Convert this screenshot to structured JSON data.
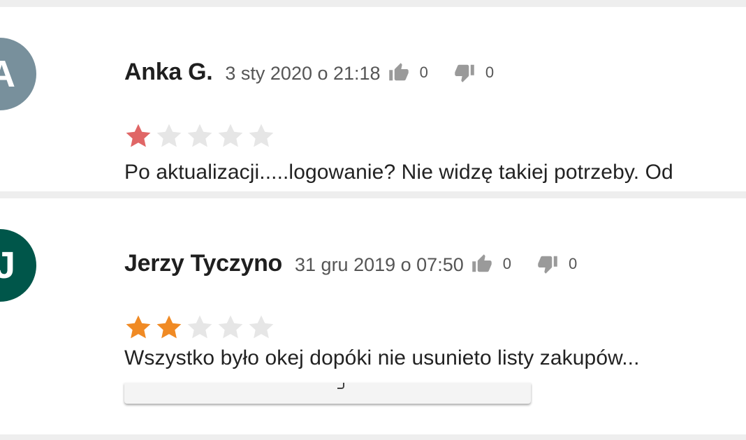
{
  "colors": {
    "star_filled_review1": "#e06666",
    "star_filled_review2": "#f08a24",
    "star_empty": "#e6e6e6",
    "vote_icon": "#9a9a9a"
  },
  "reviews": [
    {
      "avatar_initial": "A",
      "avatar_color": "#78909c",
      "author": "Anka G.",
      "date": "3 sty 2020 o 21:18",
      "likes": "0",
      "dislikes": "0",
      "rating": 1,
      "rating_max": 5,
      "text": "Po aktualizacji.....logowanie? Nie widzę takiej potrzeby. Od",
      "icons": [
        "thumbs-up-icon",
        "thumbs-down-icon",
        "star-icon"
      ]
    },
    {
      "avatar_initial": "J",
      "avatar_color": "#00564a",
      "author": "Jerzy Tyczyno",
      "date": "31 gru 2019 o 07:50",
      "likes": "0",
      "dislikes": "0",
      "rating": 2,
      "rating_max": 5,
      "text": "Wszystko było okej dopóki nie usunieto listy zakupów...",
      "icons": [
        "thumbs-up-icon",
        "thumbs-down-icon",
        "star-icon"
      ]
    }
  ]
}
